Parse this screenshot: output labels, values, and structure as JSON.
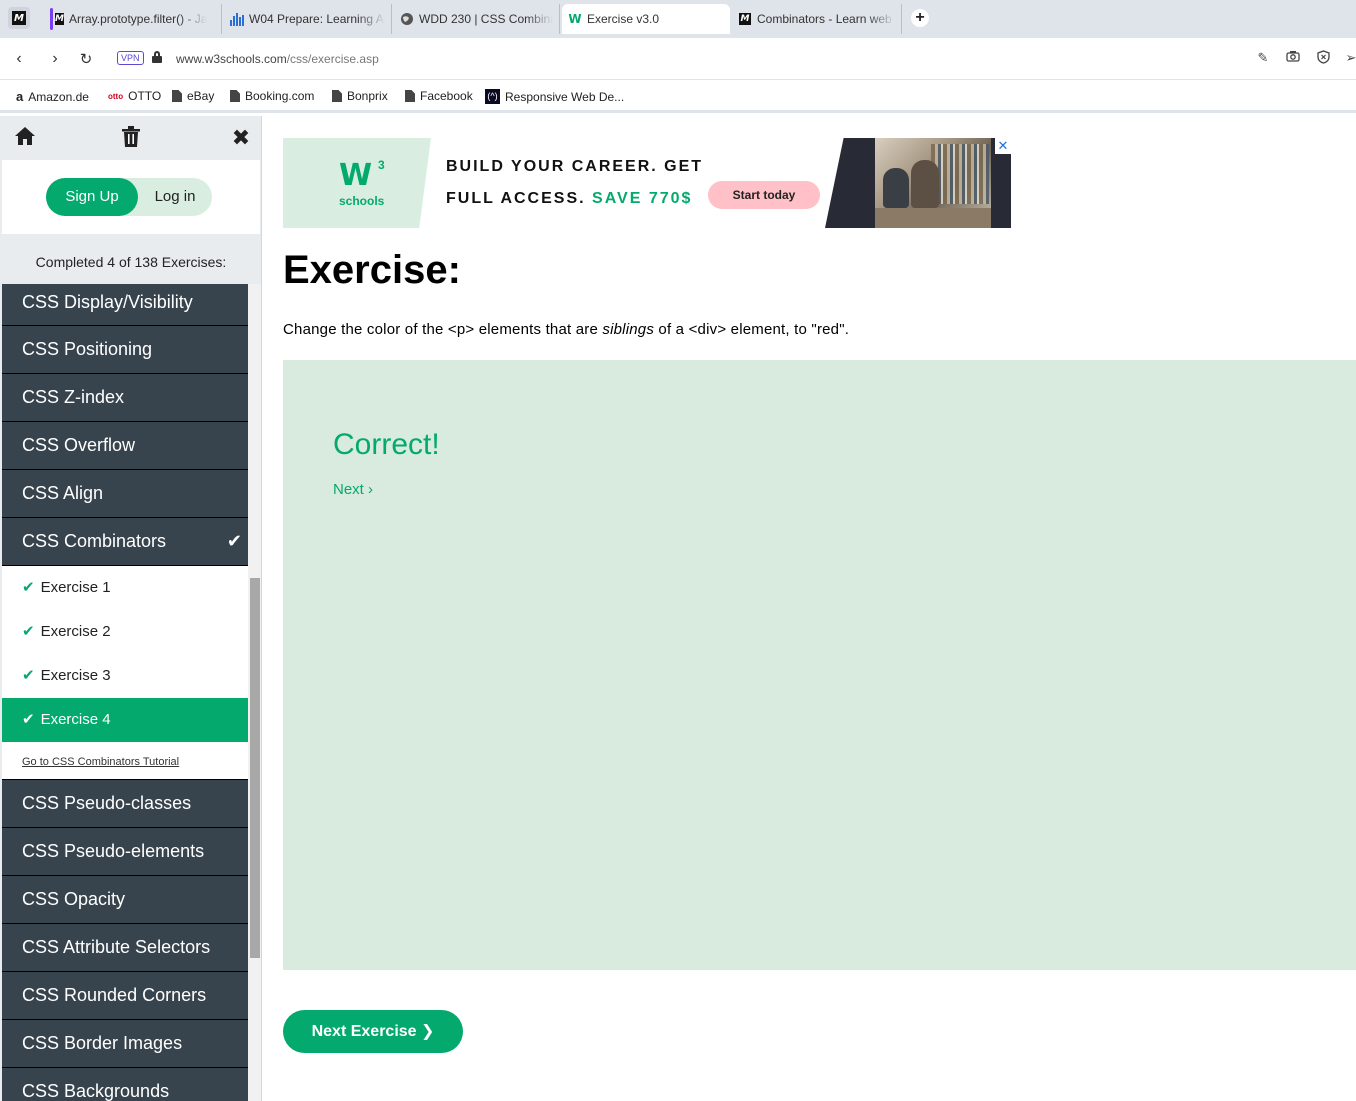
{
  "browser": {
    "tabs": [
      {
        "title": "Array.prototype.filter() - Ja",
        "icon": "mdn-icon"
      },
      {
        "title": "W04 Prepare: Learning Act",
        "icon": "chart-bars-icon"
      },
      {
        "title": "WDD 230 | CSS Combinato",
        "icon": "globe-icon"
      },
      {
        "title": "Exercise v3.0",
        "icon": "w3schools-icon"
      },
      {
        "title": "Combinators - Learn web d",
        "icon": "mdn-icon"
      }
    ],
    "new_tab": "+",
    "vpn_label": "VPN",
    "url_host": "www.w3schools.com",
    "url_path": "/css/exercise.asp",
    "bookmarks": [
      {
        "label": "Amazon.de",
        "icon": "amazon-icon"
      },
      {
        "label": "OTTO",
        "icon": "otto-icon"
      },
      {
        "label": "eBay",
        "icon": "doc-icon"
      },
      {
        "label": "Booking.com",
        "icon": "doc-icon"
      },
      {
        "label": "Bonprix",
        "icon": "doc-icon"
      },
      {
        "label": "Facebook",
        "icon": "doc-icon"
      },
      {
        "label": "Responsive Web De...",
        "icon": "freecodecamp-icon"
      }
    ]
  },
  "sidebar": {
    "signup": "Sign Up",
    "login": "Log in",
    "completed": "Completed 4 of 138 Exercises:",
    "menu_before": [
      "CSS Display/Visibility",
      "CSS Positioning",
      "CSS Z-index",
      "CSS Overflow",
      "CSS Align"
    ],
    "current_section": "CSS Combinators",
    "current_check": "✔",
    "exercises": [
      "Exercise 1",
      "Exercise 2",
      "Exercise 3",
      "Exercise 4"
    ],
    "tick": "✔",
    "tutorial_link": "Go to CSS Combinators Tutorial",
    "menu_after": [
      "CSS Pseudo-classes",
      "CSS Pseudo-elements",
      "CSS Opacity",
      "CSS Attribute Selectors",
      "CSS Rounded Corners",
      "CSS Border Images",
      "CSS Backgrounds"
    ]
  },
  "ad": {
    "logo_text": "W",
    "logo_sup": "3",
    "logo_sub": "schools",
    "line1": "BUILD YOUR CAREER. GET",
    "line2_prefix": "FULL ACCESS.",
    "line2_highlight": "SAVE 770$",
    "cta": "Start today",
    "close": "✕"
  },
  "exercise": {
    "title": "Exercise:",
    "desc_part1": "Change the color of the <p> elements that are ",
    "desc_em": "siblings",
    "desc_part2": " of a <div> element, to \"red\".",
    "result_title": "Correct!",
    "next_link": "Next ›",
    "next_exercise": "Next Exercise ❯"
  },
  "colors": {
    "accent": "#04aa6d",
    "sidebar_dark": "#38444d",
    "result_bg": "#d9eadf"
  }
}
